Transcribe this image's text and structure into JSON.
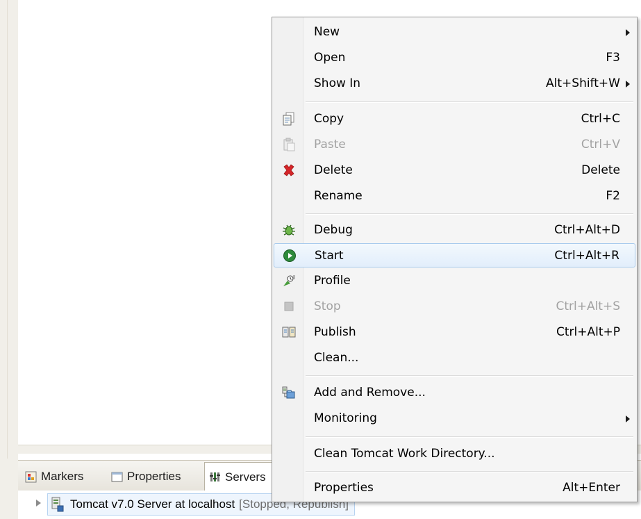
{
  "views": {
    "tabs": [
      {
        "label": "Markers",
        "icon": "markers-icon"
      },
      {
        "label": "Properties",
        "icon": "properties-icon"
      },
      {
        "label": "Servers",
        "icon": "servers-icon"
      }
    ]
  },
  "servers": {
    "row": {
      "name": "Tomcat v7.0 Server at localhost",
      "status": "[Stopped, Republish]"
    }
  },
  "context_menu": {
    "items": [
      {
        "label": "New",
        "shortcut": "",
        "submenu": true
      },
      {
        "label": "Open",
        "shortcut": "F3"
      },
      {
        "label": "Show In",
        "shortcut": "Alt+Shift+W",
        "submenu": true
      },
      {
        "label": "Copy",
        "shortcut": "Ctrl+C",
        "icon": "copy-icon"
      },
      {
        "label": "Paste",
        "shortcut": "Ctrl+V",
        "icon": "paste-icon",
        "disabled": true
      },
      {
        "label": "Delete",
        "shortcut": "Delete",
        "icon": "delete-icon"
      },
      {
        "label": "Rename",
        "shortcut": "F2"
      },
      {
        "label": "Debug",
        "shortcut": "Ctrl+Alt+D",
        "icon": "debug-icon"
      },
      {
        "label": "Start",
        "shortcut": "Ctrl+Alt+R",
        "icon": "start-icon",
        "highlighted": true
      },
      {
        "label": "Profile",
        "shortcut": "",
        "icon": "profile-icon"
      },
      {
        "label": "Stop",
        "shortcut": "Ctrl+Alt+S",
        "icon": "stop-icon",
        "disabled": true
      },
      {
        "label": "Publish",
        "shortcut": "Ctrl+Alt+P",
        "icon": "publish-icon"
      },
      {
        "label": "Clean...",
        "shortcut": ""
      },
      {
        "label": "Add and Remove...",
        "shortcut": "",
        "icon": "add-remove-icon"
      },
      {
        "label": "Monitoring",
        "shortcut": "",
        "submenu": true
      },
      {
        "label": "Clean Tomcat Work Directory...",
        "shortcut": ""
      },
      {
        "label": "Properties",
        "shortcut": "Alt+Enter"
      }
    ]
  },
  "colors": {
    "menu_bg": "#f5f5f5",
    "highlight_border": "#a9cbed",
    "disabled_text": "#a2a2a2",
    "delete_red": "#d6262a",
    "start_green": "#2e8b3c"
  }
}
